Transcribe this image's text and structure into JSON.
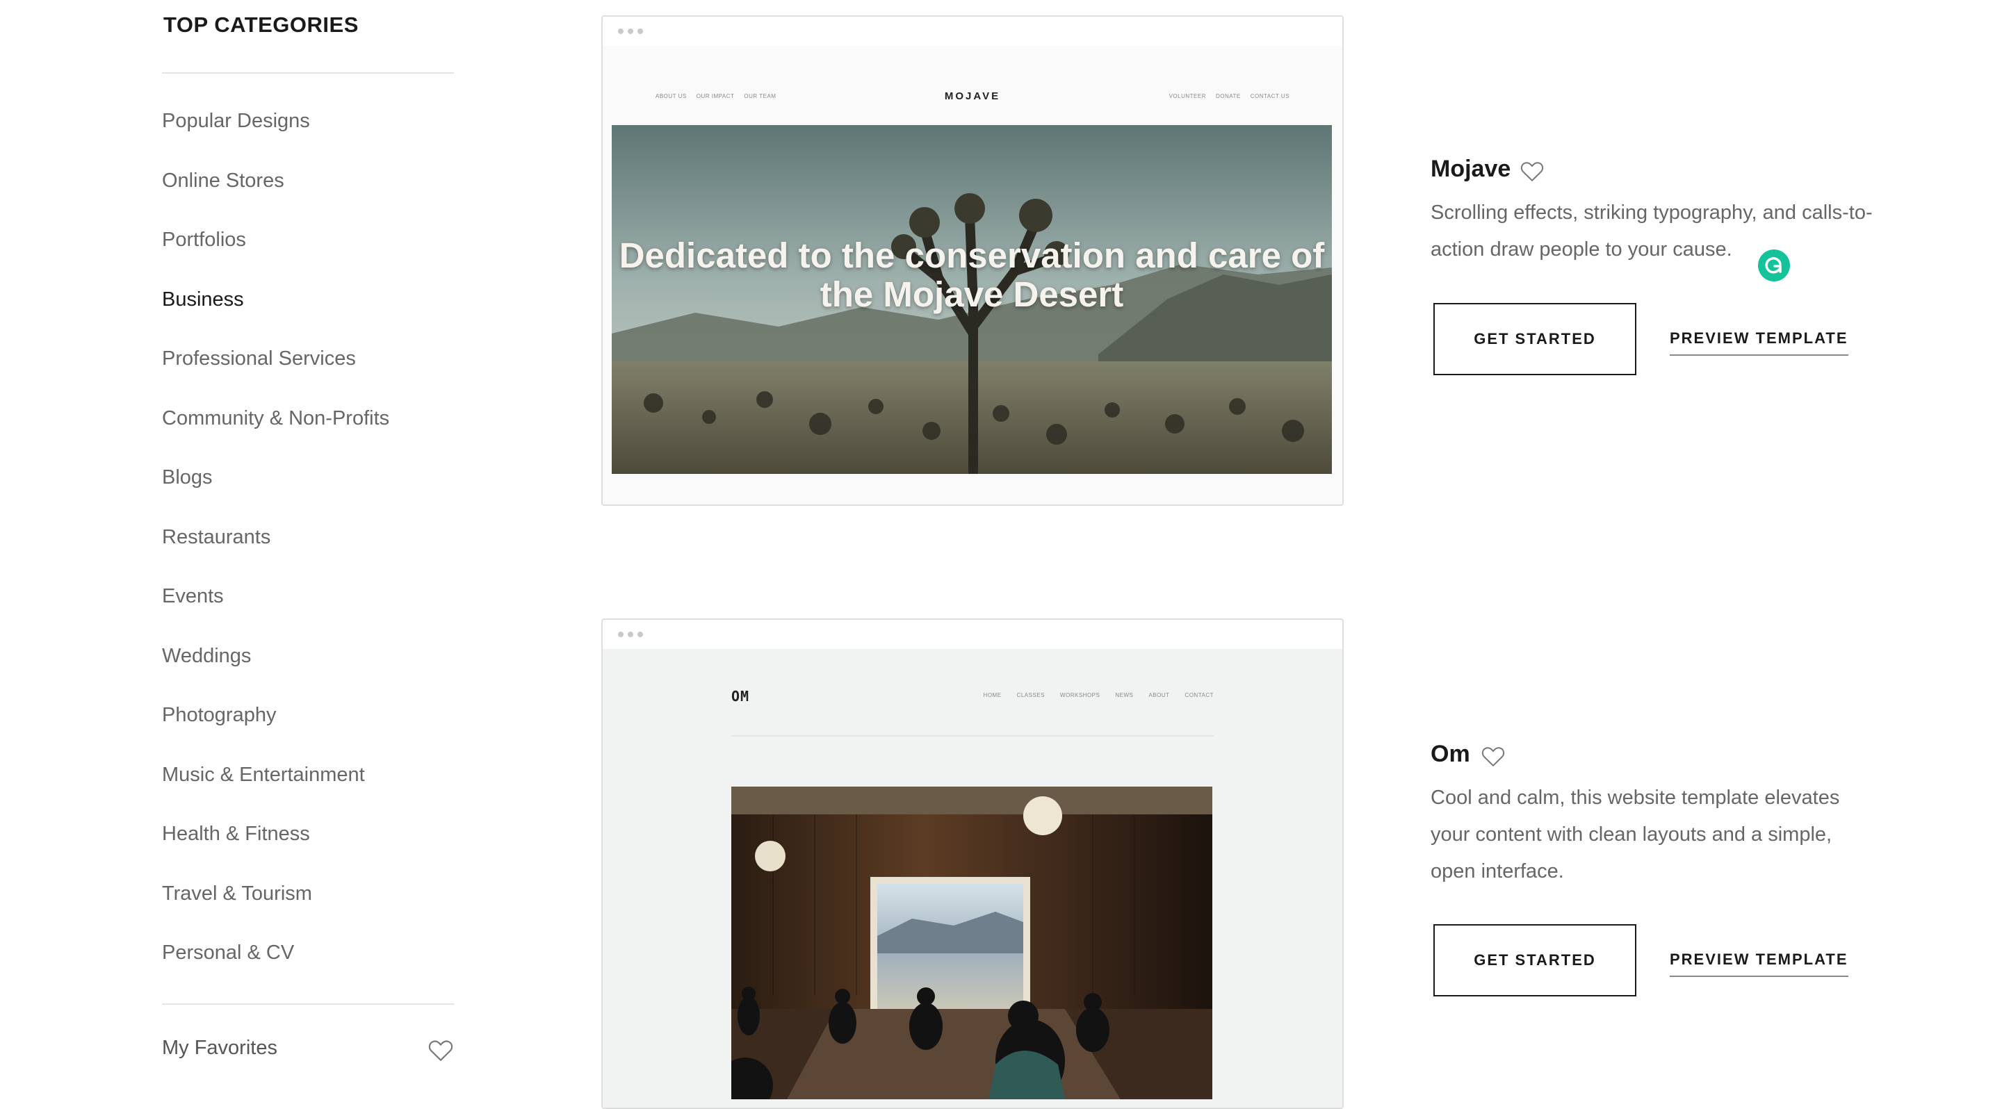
{
  "sidebar": {
    "title": "TOP CATEGORIES",
    "items": [
      {
        "label": "Popular Designs"
      },
      {
        "label": "Online Stores"
      },
      {
        "label": "Portfolios"
      },
      {
        "label": "Business"
      },
      {
        "label": "Professional Services"
      },
      {
        "label": "Community & Non-Profits"
      },
      {
        "label": "Blogs"
      },
      {
        "label": "Restaurants"
      },
      {
        "label": "Events"
      },
      {
        "label": "Weddings"
      },
      {
        "label": "Photography"
      },
      {
        "label": "Music & Entertainment"
      },
      {
        "label": "Health & Fitness"
      },
      {
        "label": "Travel & Tourism"
      },
      {
        "label": "Personal & CV"
      }
    ],
    "active_item": "Business",
    "favorites_label": "My Favorites"
  },
  "templates": [
    {
      "name": "Mojave",
      "description": "Scrolling effects, striking typography, and calls-to-action draw people to your cause.",
      "get_started_label": "GET STARTED",
      "preview_label": "PREVIEW TEMPLATE",
      "preview": {
        "brand": "MOJAVE",
        "nav_left": [
          "ABOUT US",
          "OUR IMPACT",
          "OUR TEAM"
        ],
        "nav_right": [
          "VOLUNTEER",
          "DONATE",
          "CONTACT US"
        ],
        "headline": "Dedicated to the conservation and care of the Mojave Desert"
      }
    },
    {
      "name": "Om",
      "description": "Cool and calm, this website template elevates your content with clean layouts and a simple, open interface.",
      "get_started_label": "GET STARTED",
      "preview_label": "PREVIEW TEMPLATE",
      "preview": {
        "brand": "OM",
        "nav": [
          "HOME",
          "CLASSES",
          "WORKSHOPS",
          "NEWS",
          "ABOUT",
          "CONTACT"
        ]
      }
    }
  ],
  "colors": {
    "text_dark": "#1a1a1a",
    "text_muted": "#666666",
    "grammarly_green": "#15c39a"
  },
  "icons": {
    "favorite": "heart-outline-icon",
    "window_dots": "window-dots-icon",
    "grammarly": "grammarly-icon"
  }
}
